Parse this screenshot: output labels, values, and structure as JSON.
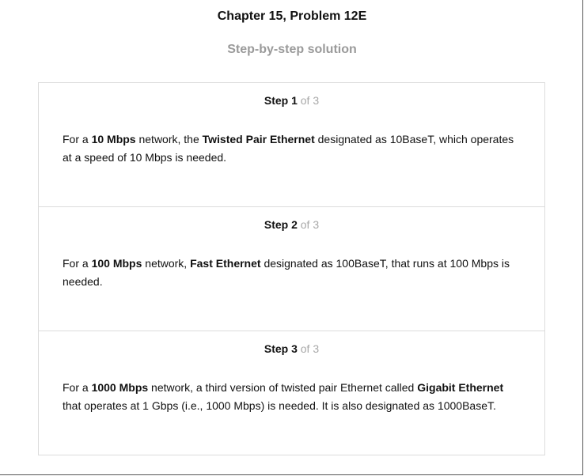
{
  "header": {
    "title": "Chapter 15, Problem 12E",
    "subtitle": "Step-by-step solution"
  },
  "steps": [
    {
      "label": "Step 1",
      "of": "of 3",
      "segments": [
        {
          "text": "For a ",
          "bold": false
        },
        {
          "text": "10 Mbps",
          "bold": true
        },
        {
          "text": " network, the ",
          "bold": false
        },
        {
          "text": "Twisted Pair Ethernet",
          "bold": true
        },
        {
          "text": " designated as 10BaseT, which operates at a speed of 10 Mbps is needed.",
          "bold": false
        }
      ]
    },
    {
      "label": "Step 2",
      "of": "of 3",
      "segments": [
        {
          "text": "For a ",
          "bold": false
        },
        {
          "text": "100 Mbps",
          "bold": true
        },
        {
          "text": " network, ",
          "bold": false
        },
        {
          "text": "Fast Ethernet",
          "bold": true
        },
        {
          "text": " designated as 100BaseT, that runs at 100 Mbps is needed.",
          "bold": false
        }
      ]
    },
    {
      "label": "Step 3",
      "of": "of 3",
      "segments": [
        {
          "text": "For a ",
          "bold": false
        },
        {
          "text": "1000 Mbps",
          "bold": true
        },
        {
          "text": " network, a third version of twisted pair Ethernet called ",
          "bold": false
        },
        {
          "text": "Gigabit Ethernet",
          "bold": true
        },
        {
          "text": " that operates at 1 Gbps (i.e., 1000 Mbps) is needed. It is also designated as 1000BaseT.",
          "bold": false
        }
      ]
    }
  ]
}
